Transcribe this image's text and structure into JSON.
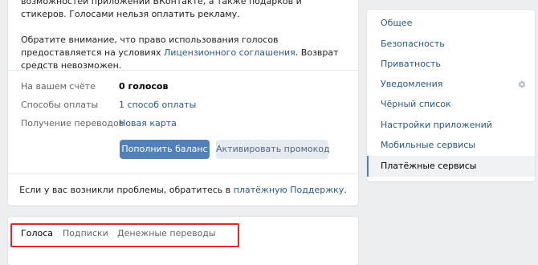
{
  "intro_text": "возможностей приложений ВКонтакте, а также подарков и стикеров. Голосами нельзя оплатить рекламу.",
  "notice": {
    "before": "Обратите внимание, что право использования голосов предоставляется на условиях ",
    "link": "Лицензионного соглашения",
    "after": ". Возврат средств невозможен."
  },
  "account": {
    "balance_label": "На вашем счёте",
    "balance_value": "0 голосов",
    "payment_label": "Способы оплаты",
    "payment_value": "1 способ оплаты",
    "transfers_label": "Получение переводов",
    "transfers_value": "Новая карта"
  },
  "buttons": {
    "topup": "Пополнить баланс",
    "promo": "Активировать промокод"
  },
  "support": {
    "before": "Если у вас возникли проблемы, обратитесь в ",
    "link": "платёжную Поддержку",
    "after": "."
  },
  "tabs": [
    "Голоса",
    "Подписки",
    "Денежные переводы"
  ],
  "sidebar": {
    "items": [
      {
        "label": "Общее"
      },
      {
        "label": "Безопасность"
      },
      {
        "label": "Приватность"
      },
      {
        "label": "Уведомления",
        "icon": "gear-icon"
      },
      {
        "label": "Чёрный список"
      },
      {
        "label": "Настройки приложений"
      },
      {
        "label": "Мобильные сервисы"
      },
      {
        "label": "Платёжные сервисы",
        "active": true
      }
    ]
  },
  "colors": {
    "accent": "#5181b8",
    "link": "#2a5885",
    "highlight": "#e0262e",
    "background": "#edeef0"
  }
}
